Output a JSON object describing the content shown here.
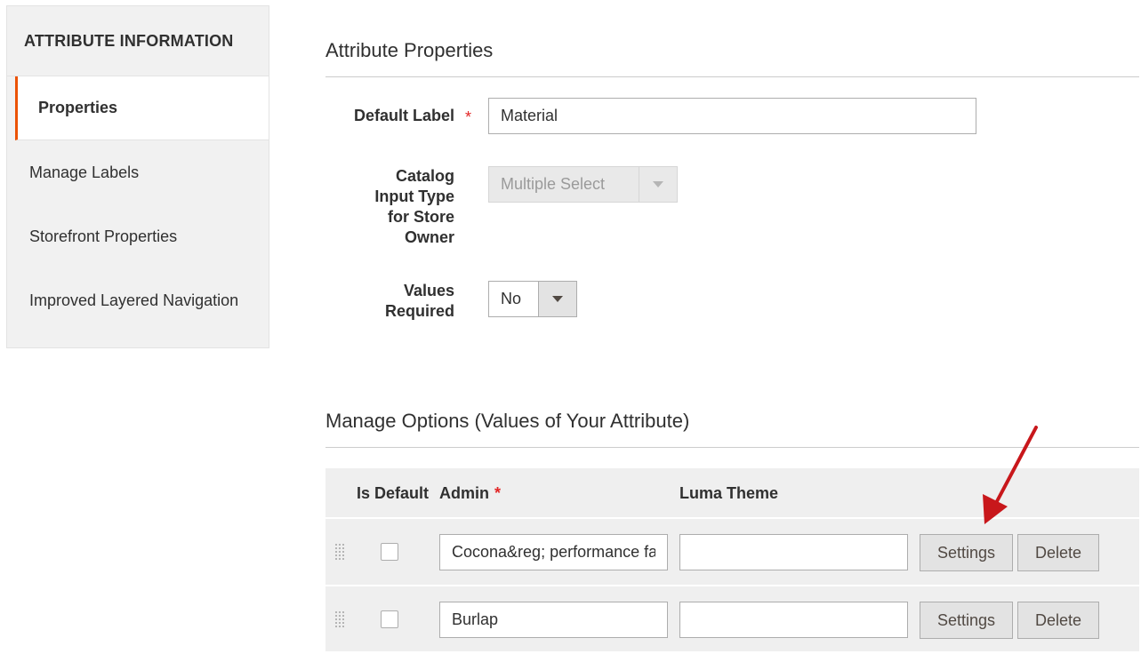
{
  "sidebar": {
    "title": "ATTRIBUTE INFORMATION",
    "items": [
      {
        "label": "Properties",
        "active": true
      },
      {
        "label": "Manage Labels",
        "active": false
      },
      {
        "label": "Storefront Properties",
        "active": false
      },
      {
        "label": "Improved Layered Navigation",
        "active": false
      }
    ]
  },
  "properties": {
    "heading": "Attribute Properties",
    "default_label": {
      "label": "Default Label",
      "required": "*",
      "value": "Material"
    },
    "input_type": {
      "label_lines": [
        "Catalog",
        "Input Type",
        "for Store",
        "Owner"
      ],
      "value": "Multiple Select",
      "disabled": true
    },
    "values_required": {
      "label_lines": [
        "Values",
        "Required"
      ],
      "value": "No"
    }
  },
  "options": {
    "heading": "Manage Options (Values of Your Attribute)",
    "columns": {
      "is_default": "Is Default",
      "admin": "Admin",
      "admin_required": "*",
      "luma": "Luma Theme"
    },
    "rows": [
      {
        "admin": "Cocona&reg; performance fa",
        "luma": "",
        "settings": "Settings",
        "delete": "Delete"
      },
      {
        "admin": "Burlap",
        "luma": "",
        "settings": "Settings",
        "delete": "Delete"
      }
    ]
  },
  "colors": {
    "accent": "#eb5202",
    "required": "#e22626",
    "annotation_arrow": "#c8171b"
  }
}
